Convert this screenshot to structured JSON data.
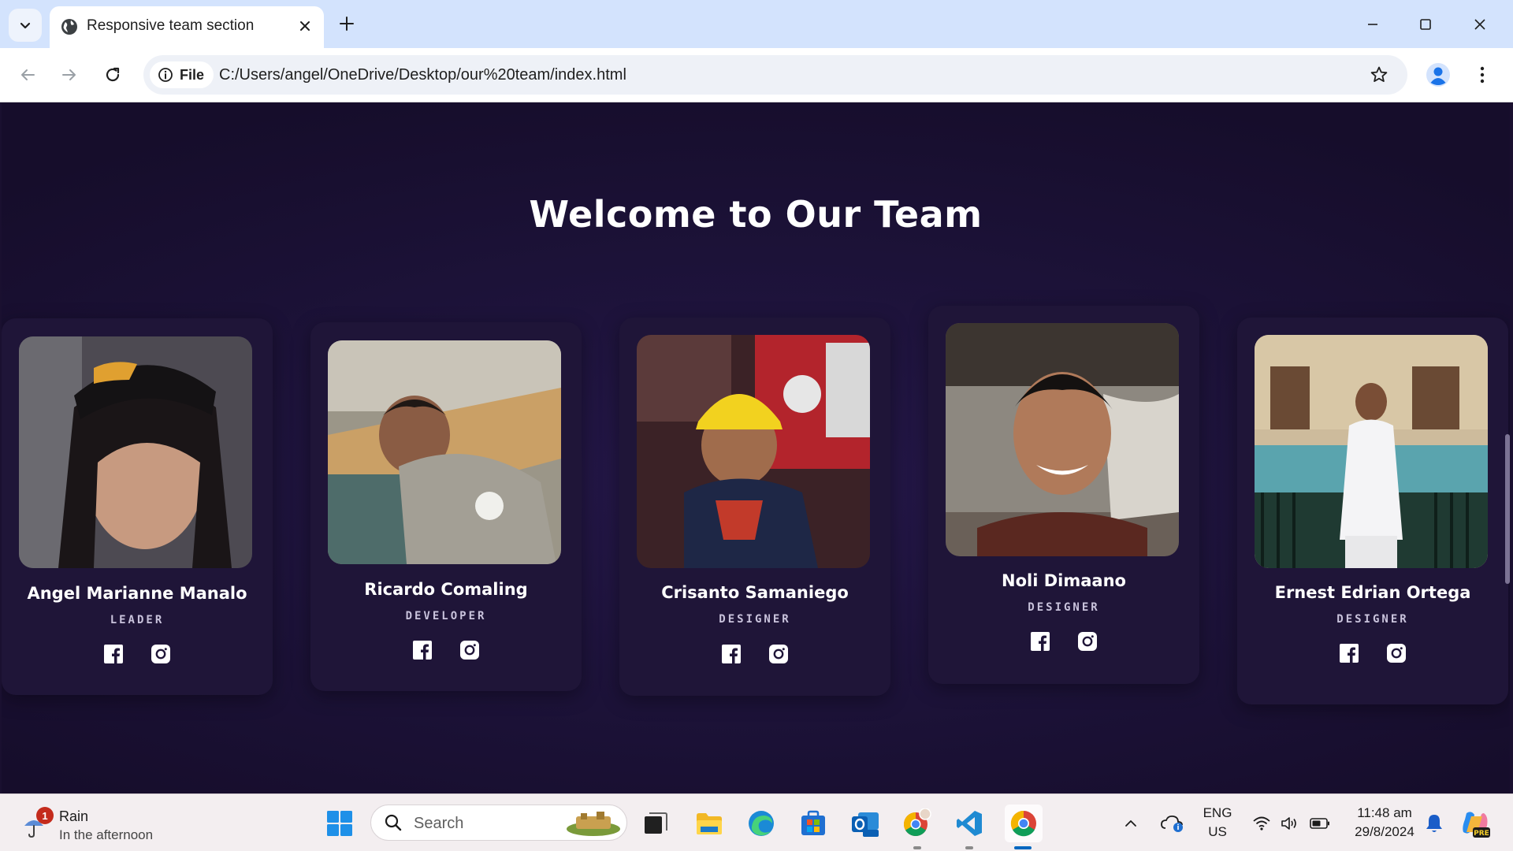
{
  "browser": {
    "tab_title": "Responsive team section",
    "address_chip": "File",
    "url": "C:/Users/angel/OneDrive/Desktop/our%20team/index.html"
  },
  "page": {
    "heading": "Welcome to Our Team",
    "members": [
      {
        "name": "Angel Marianne Manalo",
        "role": "LEADER",
        "photo_bg": "#3d3a40"
      },
      {
        "name": "Ricardo Comaling",
        "role": "DEVELOPER",
        "photo_bg": "#8a8579"
      },
      {
        "name": "Crisanto Samaniego",
        "role": "DESIGNER",
        "photo_bg": "#4a2b2f"
      },
      {
        "name": "Noli Dimaano",
        "role": "DESIGNER",
        "photo_bg": "#5b5550"
      },
      {
        "name": "Ernest Edrian Ortega",
        "role": "DESIGNER",
        "photo_bg": "#6aa8b0"
      }
    ],
    "social_icons": [
      "facebook-icon",
      "instagram-icon"
    ]
  },
  "taskbar": {
    "weather_badge": "1",
    "weather_title": "Rain",
    "weather_subtitle": "In the afternoon",
    "search_placeholder": "Search",
    "lang_top": "ENG",
    "lang_bottom": "US",
    "time": "11:48 am",
    "date": "29/8/2024"
  },
  "colors": {
    "page_bg": "#1c1238",
    "card_bg": "#1f1538",
    "tabstrip": "#d3e3fd",
    "accent": "#1a73e8"
  }
}
